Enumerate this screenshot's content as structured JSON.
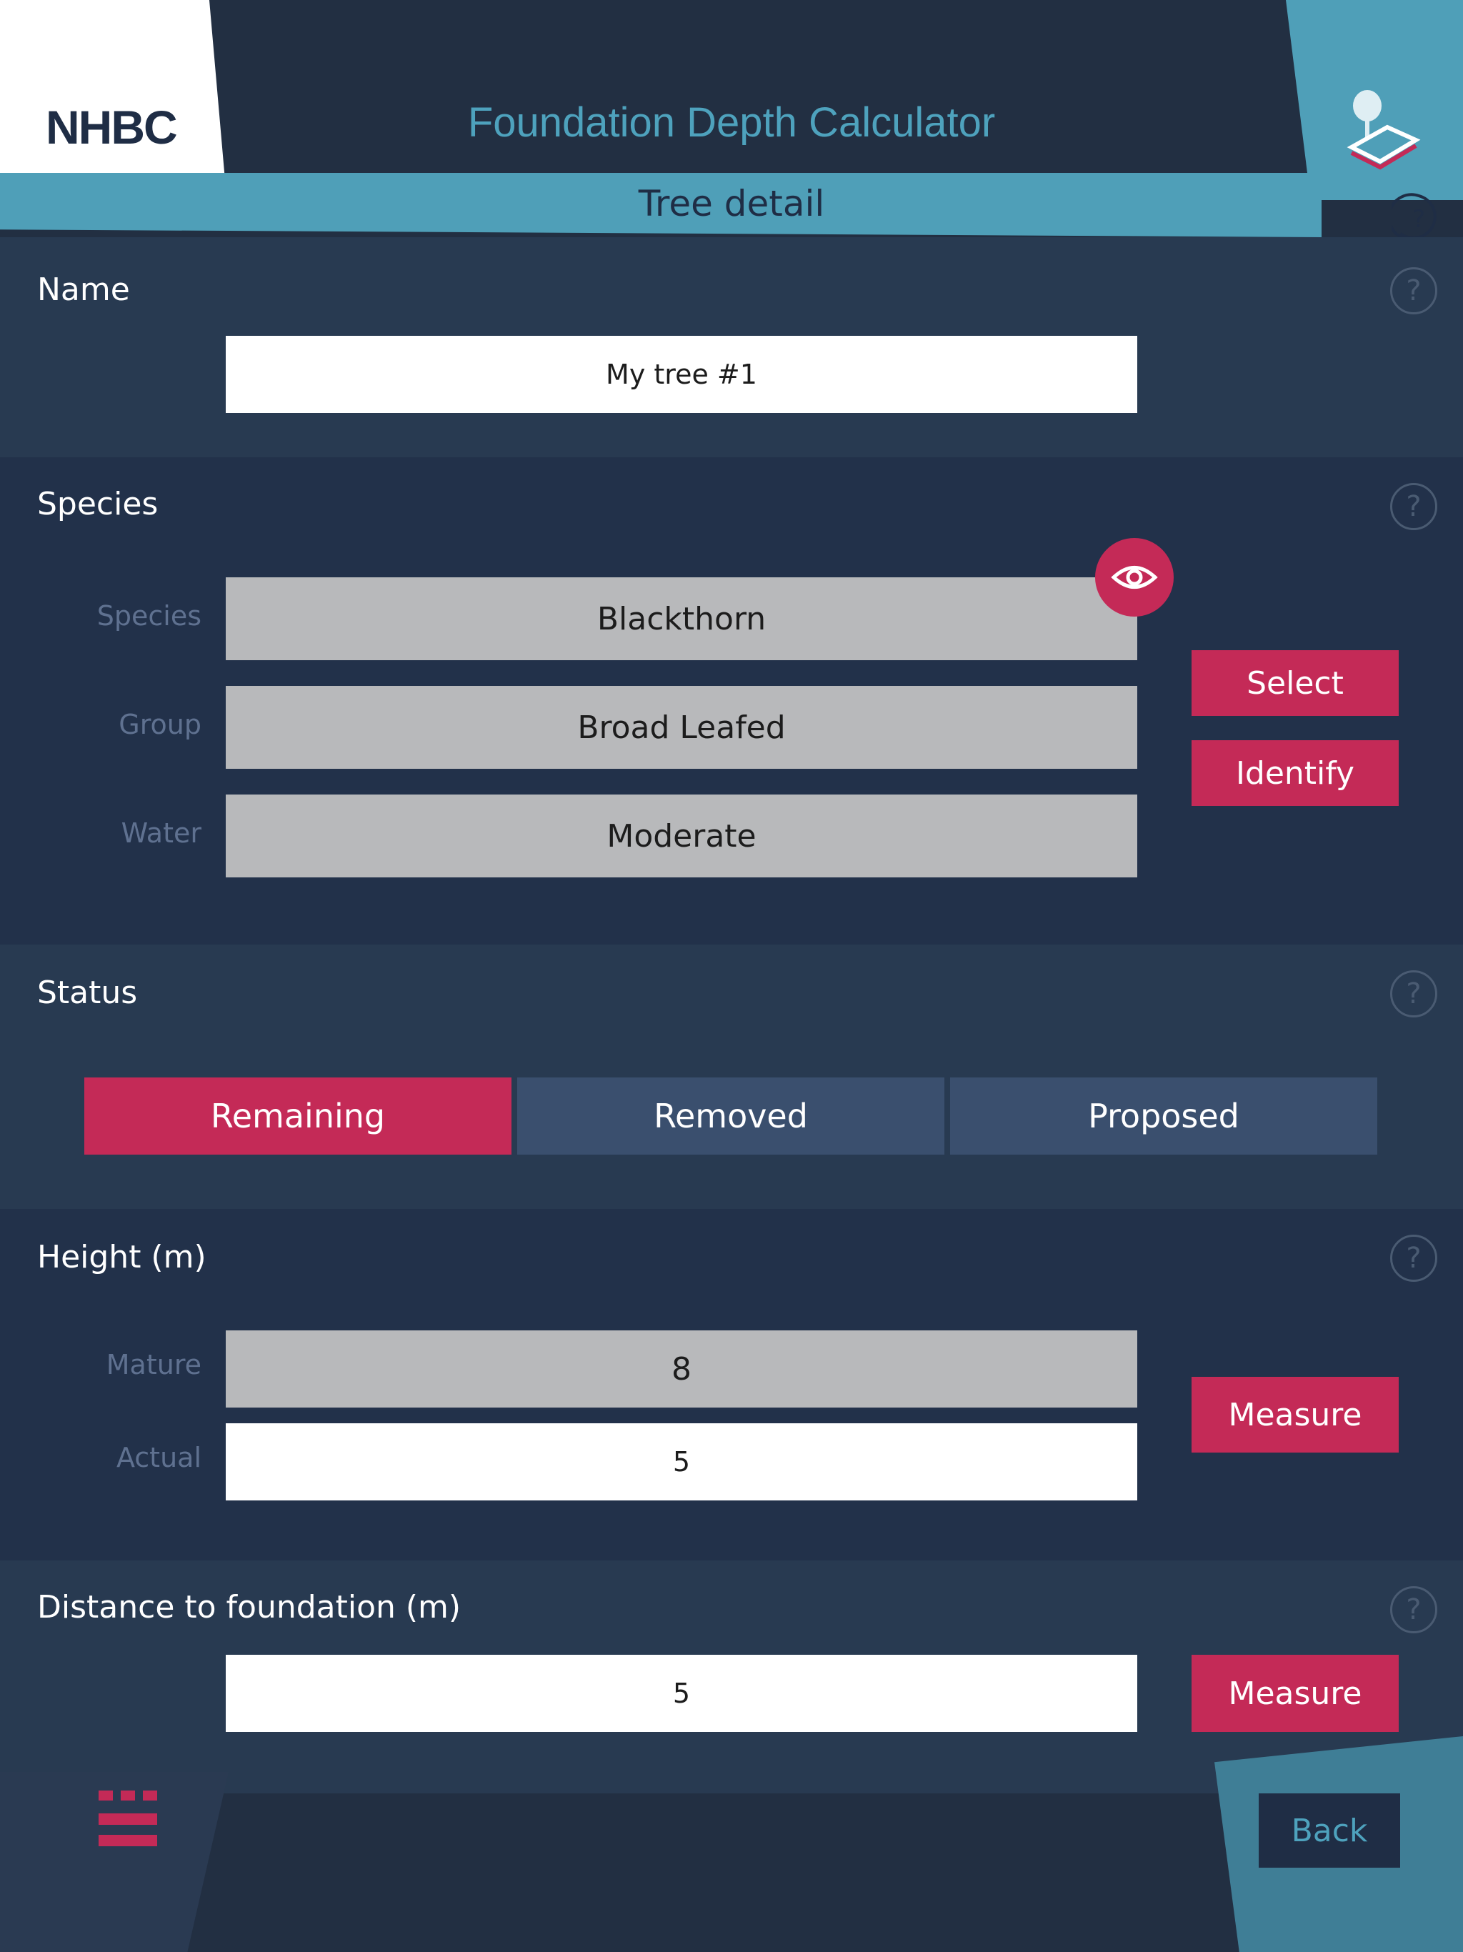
{
  "header": {
    "logo": "NHBC",
    "app_title": "Foundation Depth Calculator",
    "subtitle": "Tree detail"
  },
  "name_section": {
    "title": "Name",
    "value": "My tree #1"
  },
  "species_section": {
    "title": "Species",
    "rows": [
      {
        "label": "Species",
        "value": "Blackthorn"
      },
      {
        "label": "Group",
        "value": "Broad Leafed"
      },
      {
        "label": "Water",
        "value": "Moderate"
      }
    ],
    "select_label": "Select",
    "identify_label": "Identify"
  },
  "status_section": {
    "title": "Status",
    "options": [
      "Remaining",
      "Removed",
      "Proposed"
    ],
    "selected": "Remaining"
  },
  "height_section": {
    "title": "Height (m)",
    "mature_label": "Mature",
    "mature_value": "8",
    "actual_label": "Actual",
    "actual_value": "5",
    "measure_label": "Measure"
  },
  "distance_section": {
    "title": "Distance to foundation (m)",
    "value": "5",
    "measure_label": "Measure"
  },
  "footer": {
    "back_label": "Back"
  },
  "colors": {
    "accent": "#c42a57",
    "teal": "#4f9fb8",
    "navy": "#1f2d45"
  },
  "icons": [
    "tree-house-icon",
    "help-icon",
    "eye-icon",
    "menu-icon"
  ]
}
